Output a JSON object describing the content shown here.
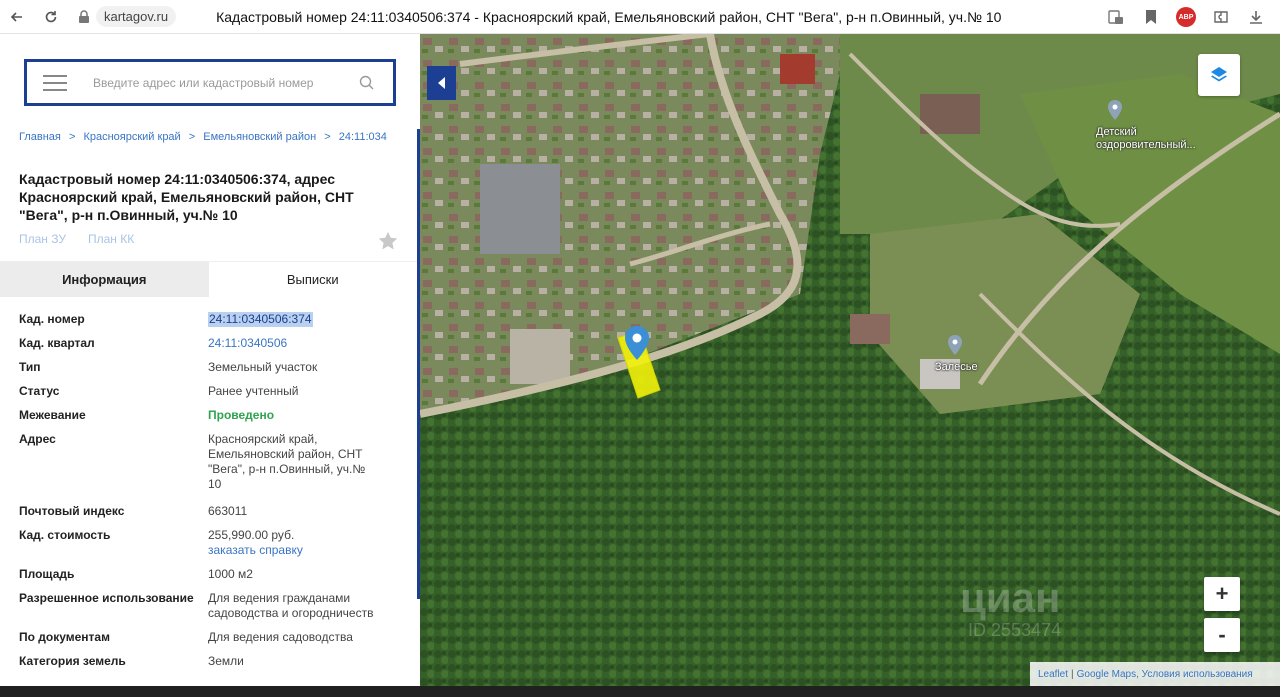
{
  "browser": {
    "domain": "kartagov.ru",
    "page_title": "Кадастровый номер 24:11:0340506:374 - Красноярский край, Емельяновский район, СНТ \"Вега\", р-н п.Овинный, уч.№ 10",
    "abp_label": "ABP"
  },
  "search": {
    "placeholder": "Введите адрес или кадастровый номер"
  },
  "breadcrumb": {
    "items": [
      "Главная",
      "Красноярский край",
      "Емельяновский район",
      "24:11:034"
    ],
    "separator": ">"
  },
  "title": "Кадастровый номер 24:11:0340506:374, адрес Красноярский край, Емельяновский район, СНТ \"Вега\", р-н п.Овинный, уч.№ 10",
  "plan_links": [
    "План ЗУ",
    "План КК"
  ],
  "tabs": [
    "Информация",
    "Выписки"
  ],
  "info": {
    "rows": [
      {
        "key": "Кад. номер",
        "value": "24:11:0340506:374"
      },
      {
        "key": "Кад. квартал",
        "value": "24:11:0340506"
      },
      {
        "key": "Тип",
        "value": "Земельный участок"
      },
      {
        "key": "Статус",
        "value": "Ранее учтенный"
      },
      {
        "key": "Межевание",
        "value": "Проведено"
      },
      {
        "key": "Адрес",
        "value": "Красноярский край, Емельяновский район, СНТ \"Вега\", р-н п.Овинный, уч.№ 10"
      },
      {
        "key": "Почтовый индекс",
        "value": "663011"
      },
      {
        "key": "Кад. стоимость",
        "value": "255,990.00 руб.",
        "sub": "заказать справку"
      },
      {
        "key": "Площадь",
        "value": "1000 м2"
      },
      {
        "key": "Разрешенное использование",
        "value": "Для ведения гражданами садоводства и огородничеств"
      },
      {
        "key": "По документам",
        "value": "Для ведения садоводства"
      },
      {
        "key": "Категория земель",
        "value": "Земли"
      }
    ]
  },
  "map": {
    "labels": {
      "camp": "Детский оздоровительный...",
      "village": "Залесье"
    },
    "zoom_in": "+",
    "zoom_out": "-",
    "attribution": [
      "Leaflet",
      "Google Maps, Условия использования"
    ],
    "watermark": "циан",
    "watermark_id": "ID 2553474"
  },
  "colors": {
    "accent": "#1c3f94",
    "link": "#3a74c4",
    "status_green": "#2ea44f",
    "parcel": "#f2f20a"
  }
}
